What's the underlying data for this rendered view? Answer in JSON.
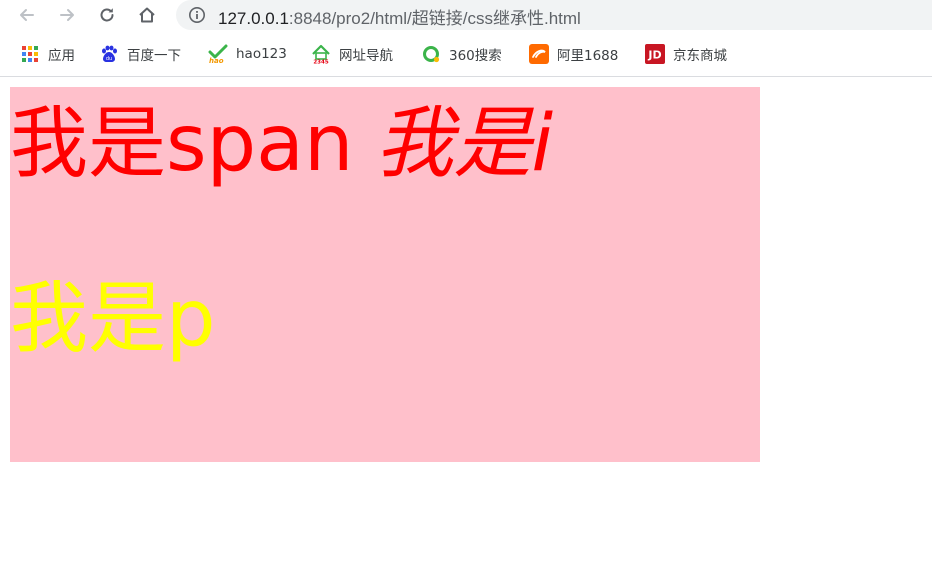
{
  "browser": {
    "url_host": "127.0.0.1",
    "url_path": ":8848/pro2/html/超链接/css继承性.html"
  },
  "bookmarks": [
    {
      "label": "应用",
      "icon": "apps-grid-icon"
    },
    {
      "label": "百度一下",
      "icon": "baidu-paw-icon"
    },
    {
      "label": "hao123",
      "icon": "hao123-icon"
    },
    {
      "label": "网址导航",
      "icon": "2345-house-icon"
    },
    {
      "label": "360搜索",
      "icon": "360-search-icon"
    },
    {
      "label": "阿里1688",
      "icon": "ali1688-icon"
    },
    {
      "label": "京东商城",
      "icon": "jd-icon"
    }
  ],
  "page": {
    "span_text": "我是span",
    "i_text": "我是i",
    "p_text": "我是p",
    "colors": {
      "box_background": "pink",
      "inline_text": "red",
      "p_text": "yellow"
    }
  }
}
